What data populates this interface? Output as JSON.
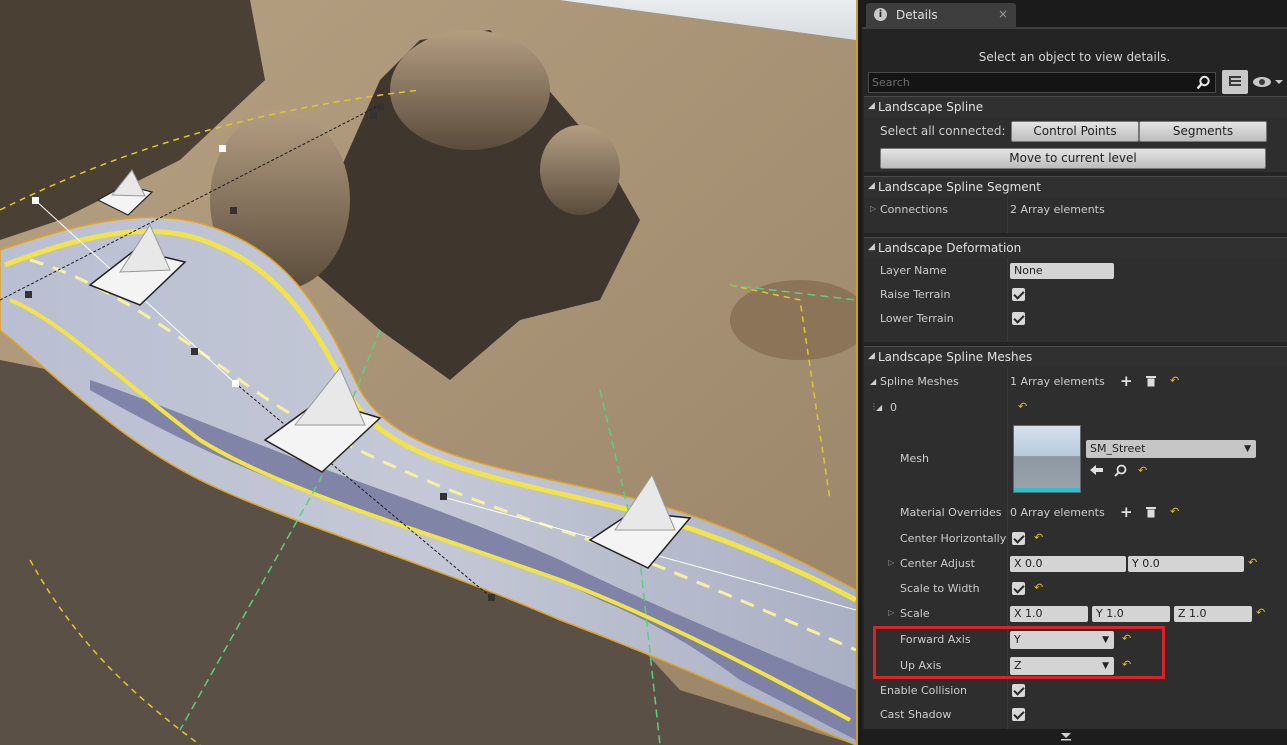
{
  "details_tab": {
    "title": "Details",
    "close": "×"
  },
  "hint": "Select an object to view details.",
  "search": {
    "placeholder": "Search"
  },
  "landscape_spline": {
    "title": "Landscape Spline",
    "select_all_label": "Select all connected:",
    "control_points_button": "Control Points",
    "segments_button": "Segments",
    "move_button": "Move to current level"
  },
  "segment": {
    "title": "Landscape Spline Segment",
    "connections_label": "Connections",
    "connections_value": "2 Array elements"
  },
  "deformation": {
    "title": "Landscape Deformation",
    "layer_name_label": "Layer Name",
    "layer_name_value": "None",
    "raise_terrain_label": "Raise Terrain",
    "raise_terrain_checked": true,
    "lower_terrain_label": "Lower Terrain",
    "lower_terrain_checked": true
  },
  "meshes": {
    "title": "Landscape Spline Meshes",
    "spline_meshes_label": "Spline Meshes",
    "spline_meshes_value": "1 Array elements",
    "index_label": "0",
    "mesh_label": "Mesh",
    "mesh_value": "SM_Street",
    "material_overrides_label": "Material Overrides",
    "material_overrides_value": "0 Array elements",
    "center_horizontally_label": "Center Horizontally",
    "center_adjust_label": "Center Adjust",
    "center_adjust_x": "X  0.0",
    "center_adjust_y": "Y  0.0",
    "scale_to_width_label": "Scale to Width",
    "scale_label": "Scale",
    "scale_x": "X  1.0",
    "scale_y": "Y  1.0",
    "scale_z": "Z  1.0",
    "forward_axis_label": "Forward Axis",
    "forward_axis_value": "Y",
    "up_axis_label": "Up Axis",
    "up_axis_value": "Z",
    "enable_collision_label": "Enable Collision",
    "cast_shadow_label": "Cast Shadow"
  },
  "colors": {
    "highlight_box": "#d8232a",
    "reset_arrow": "#e5c21e",
    "viewport_border": "#c9a227"
  }
}
